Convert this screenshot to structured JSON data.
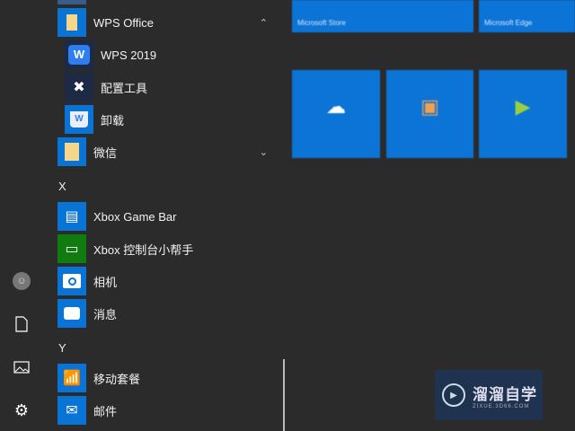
{
  "apps": [
    {
      "label": "WPS Office",
      "type": "folder",
      "expanded": true
    },
    {
      "label": "WPS 2019",
      "type": "sub"
    },
    {
      "label": "配置工具",
      "type": "sub"
    },
    {
      "label": "卸载",
      "type": "sub"
    },
    {
      "label": "微信",
      "type": "folder",
      "expanded": false
    },
    {
      "label": "X",
      "type": "header"
    },
    {
      "label": "Xbox Game Bar"
    },
    {
      "label": "Xbox 控制台小帮手"
    },
    {
      "label": "相机"
    },
    {
      "label": "消息"
    },
    {
      "label": "Y",
      "type": "header"
    },
    {
      "label": "移动套餐"
    },
    {
      "label": "邮件"
    }
  ],
  "tiles": {
    "store": "Microsoft Store",
    "edge": "Microsoft Edge"
  },
  "watermark": {
    "title": "溜溜自学",
    "url": "ZIXUE.3D66.COM"
  },
  "colors": {
    "bg": "#2b2b2b",
    "tile": "#0b74d6",
    "xbox": "#107c10"
  }
}
